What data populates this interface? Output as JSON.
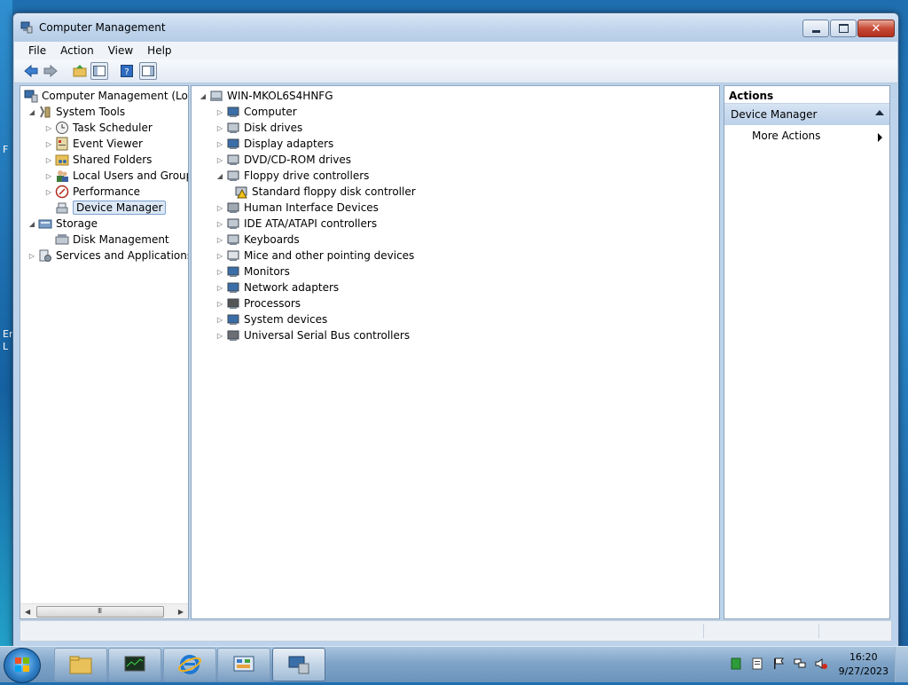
{
  "window": {
    "title": "Computer Management"
  },
  "menu": [
    "File",
    "Action",
    "View",
    "Help"
  ],
  "toolbar": {
    "buttons": [
      "back-icon",
      "forward-icon",
      "up-folder-icon",
      "show-hide-tree-icon",
      "help-icon",
      "properties-icon"
    ]
  },
  "tree": {
    "root": "Computer Management (Local",
    "system_tools": "System Tools",
    "task_scheduler": "Task Scheduler",
    "event_viewer": "Event Viewer",
    "shared_folders": "Shared Folders",
    "local_users": "Local Users and Groups",
    "performance": "Performance",
    "device_manager": "Device Manager",
    "storage": "Storage",
    "disk_management": "Disk Management",
    "services_apps": "Services and Applications"
  },
  "devices": {
    "host": "WIN-MKOL6S4HNFG",
    "categories": [
      "Computer",
      "Disk drives",
      "Display adapters",
      "DVD/CD-ROM drives",
      "Floppy drive controllers",
      "Standard floppy disk controller",
      "Human Interface Devices",
      "IDE ATA/ATAPI controllers",
      "Keyboards",
      "Mice and other pointing devices",
      "Monitors",
      "Network adapters",
      "Processors",
      "System devices",
      "Universal Serial Bus controllers"
    ]
  },
  "actions": {
    "header": "Actions",
    "section": "Device Manager",
    "more": "More Actions"
  },
  "taskbar": {
    "apps": [
      "explorer-icon",
      "task-manager-icon",
      "internet-explorer-icon",
      "control-panel-icon",
      "computer-management-icon"
    ]
  },
  "clock": {
    "time": "16:20",
    "date": "9/27/2023"
  },
  "desktop_edge": {
    "line1": "F",
    "line2": "Er",
    "line3": "L"
  }
}
